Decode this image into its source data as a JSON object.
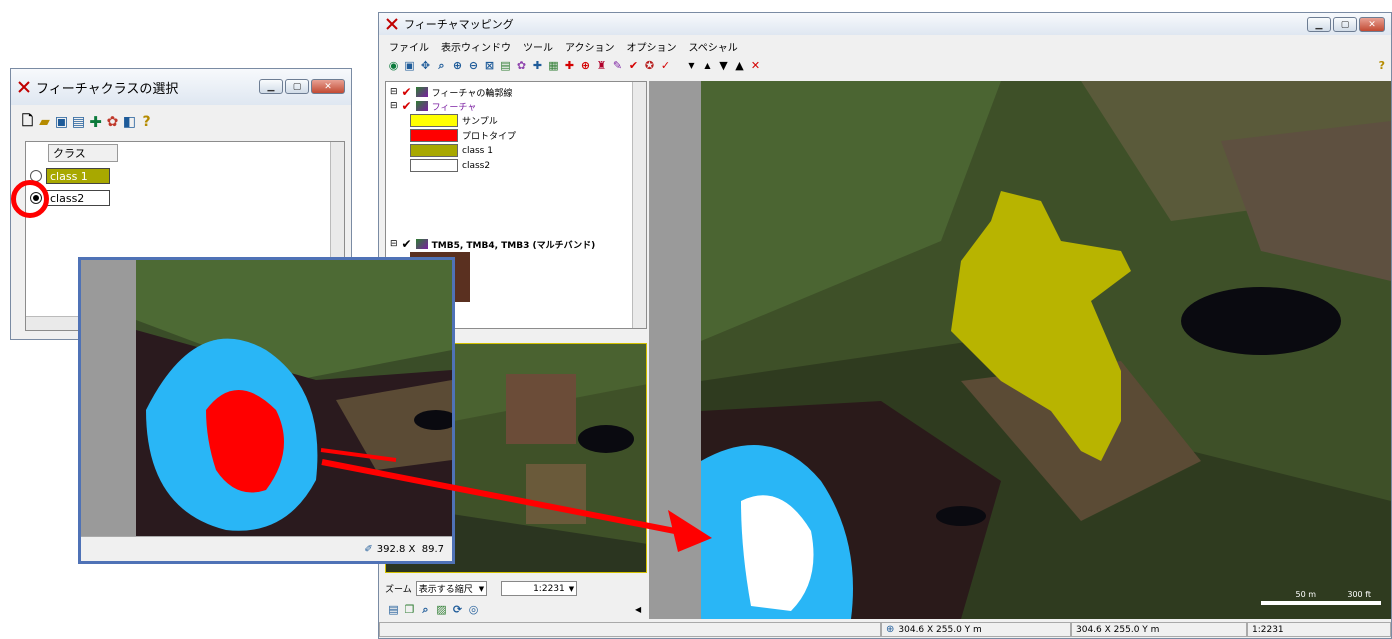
{
  "main_window": {
    "title": "フィーチャマッピング",
    "menu": [
      "ファイル",
      "表示ウィンドウ",
      "ツール",
      "アクション",
      "オプション",
      "スペシャル"
    ],
    "help_glyph": "?",
    "legend": {
      "root_label": "フィーチャの輪郭線",
      "feature_group": "フィーチャ",
      "items": [
        {
          "label": "サンプル",
          "color": "#ffff00"
        },
        {
          "label": "プロトタイプ",
          "color": "#ff0000"
        },
        {
          "label": "class 1",
          "color": "#a8a800"
        },
        {
          "label": "class2",
          "color": "#ffffff"
        }
      ],
      "raster_label": "TMB5, TMB4, TMB3 (マルチバンド)"
    },
    "zoom": {
      "label": "ズーム",
      "mode": "表示する縮尺",
      "scale": "1:2231"
    },
    "scale_bar": {
      "left": "50 m",
      "right": "300 ft"
    },
    "status": {
      "coord1": "304.6 X 255.0 Y m",
      "coord2": "304.6 X 255.0 Y m",
      "scale": "1:2231"
    }
  },
  "class_window": {
    "title": "フィーチャクラスの選択",
    "column_header": "クラス",
    "classes": [
      {
        "label": "class 1",
        "color": "#a8a800",
        "selected": false
      },
      {
        "label": "class2",
        "color": "#ffffff",
        "selected": true
      }
    ]
  },
  "inset": {
    "status": "392.8 X  89.7"
  },
  "colors": {
    "titlebar": "#dfe7f1",
    "highlight": "#ff0000",
    "snow": "#29b6f6"
  }
}
